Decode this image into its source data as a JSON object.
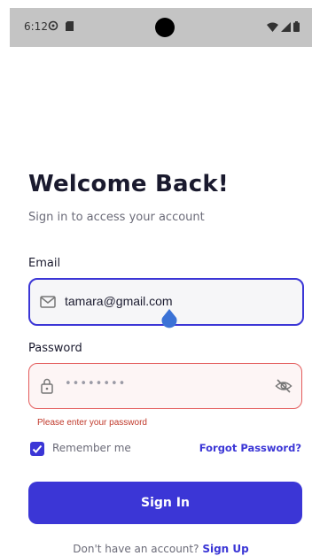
{
  "status_bar": {
    "time": "6:12",
    "icons_left": [
      "gear-icon",
      "sd-card-icon"
    ],
    "icons_right": [
      "wifi-icon",
      "signal-icon",
      "battery-icon"
    ]
  },
  "title": "Welcome Back!",
  "subtitle": "Sign in to access your account",
  "email": {
    "label": "Email",
    "value": "tamara@gmail.com",
    "icon": "mail-icon"
  },
  "password": {
    "label": "Password",
    "placeholder": "••••••••",
    "icon": "lock-icon",
    "toggle_icon": "eye-off-icon",
    "error": "Please enter your password"
  },
  "remember_me": {
    "label": "Remember me",
    "checked": true
  },
  "forgot_password": "Forgot Password?",
  "sign_in_button": "Sign In",
  "signup_prompt": "Don't have an account?",
  "signup_link": "Sign Up",
  "colors": {
    "primary": "#3b36d6",
    "error": "#c0392b",
    "status_bar": "#c4c4c4"
  }
}
